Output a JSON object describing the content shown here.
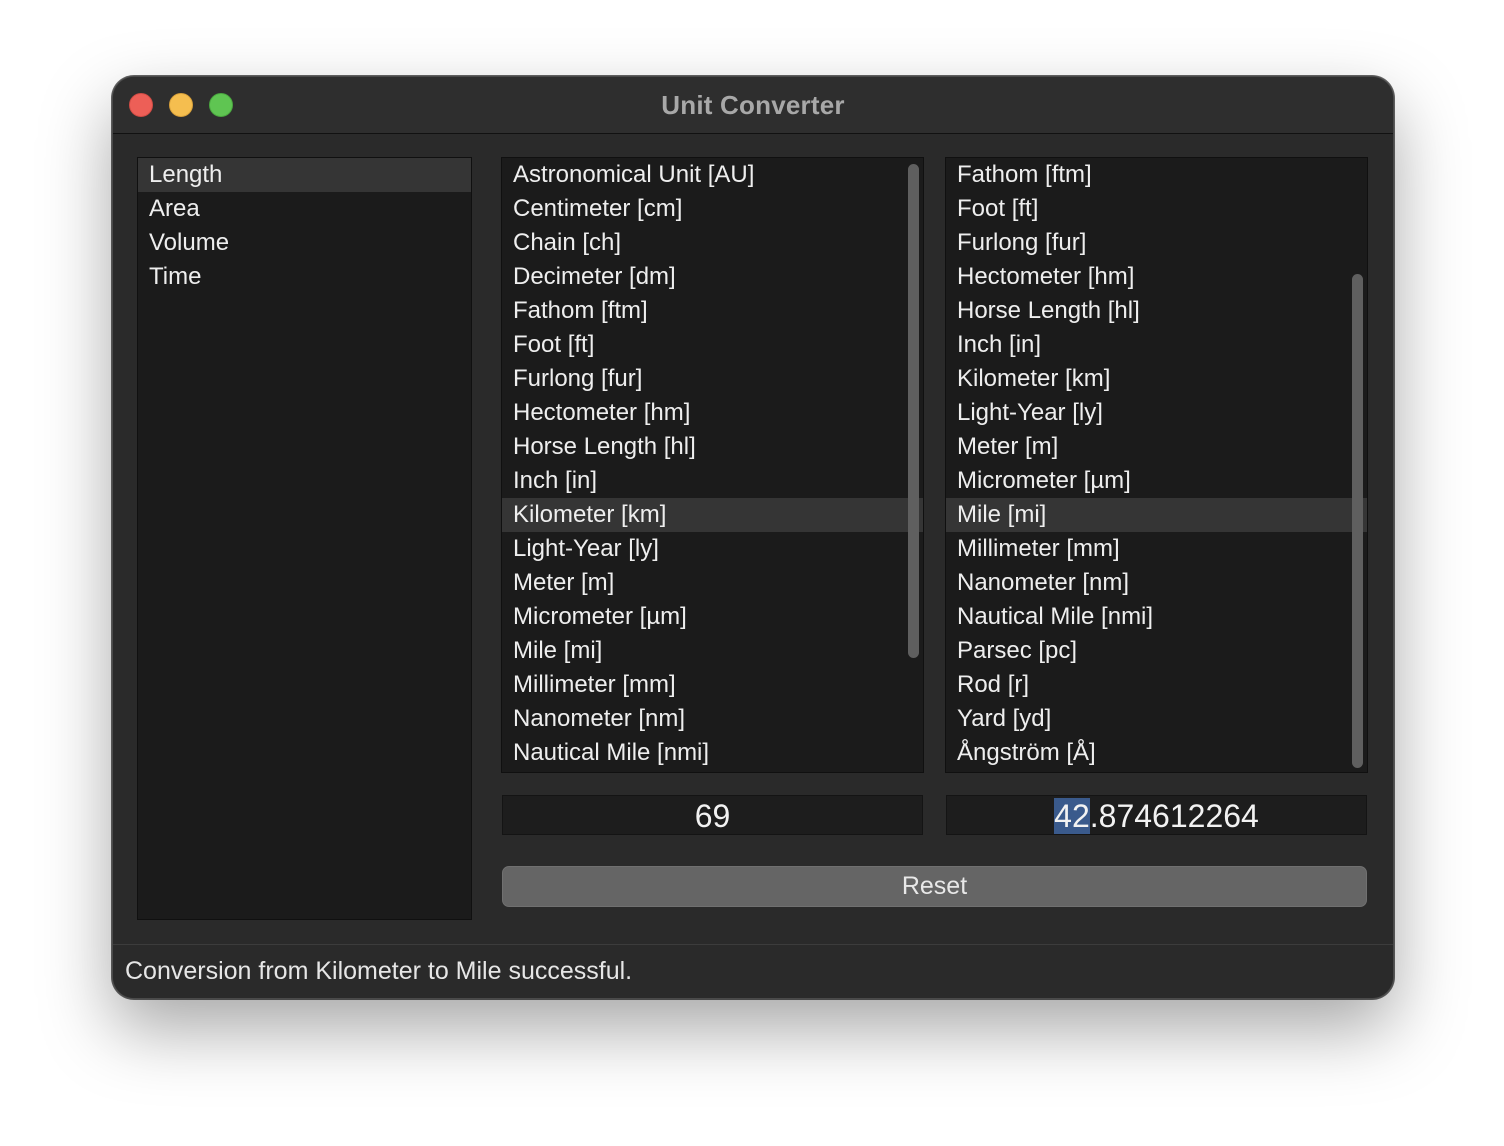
{
  "window": {
    "title": "Unit Converter"
  },
  "categories": {
    "items": [
      {
        "label": "Length"
      },
      {
        "label": "Area"
      },
      {
        "label": "Volume"
      },
      {
        "label": "Time"
      }
    ],
    "selected": "Length"
  },
  "from_units": {
    "items": [
      {
        "label": "Astronomical Unit [AU]"
      },
      {
        "label": "Centimeter [cm]"
      },
      {
        "label": "Chain [ch]"
      },
      {
        "label": "Decimeter [dm]"
      },
      {
        "label": "Fathom [ftm]"
      },
      {
        "label": "Foot [ft]"
      },
      {
        "label": "Furlong [fur]"
      },
      {
        "label": "Hectometer [hm]"
      },
      {
        "label": "Horse Length [hl]"
      },
      {
        "label": "Inch [in]"
      },
      {
        "label": "Kilometer [km]"
      },
      {
        "label": "Light-Year [ly]"
      },
      {
        "label": "Meter [m]"
      },
      {
        "label": "Micrometer [µm]"
      },
      {
        "label": "Mile [mi]"
      },
      {
        "label": "Millimeter [mm]"
      },
      {
        "label": "Nanometer [nm]"
      },
      {
        "label": "Nautical Mile [nmi]"
      }
    ],
    "selected": "Kilometer [km]"
  },
  "to_units": {
    "items": [
      {
        "label": "Fathom [ftm]"
      },
      {
        "label": "Foot [ft]"
      },
      {
        "label": "Furlong [fur]"
      },
      {
        "label": "Hectometer [hm]"
      },
      {
        "label": "Horse Length [hl]"
      },
      {
        "label": "Inch [in]"
      },
      {
        "label": "Kilometer [km]"
      },
      {
        "label": "Light-Year [ly]"
      },
      {
        "label": "Meter [m]"
      },
      {
        "label": "Micrometer [µm]"
      },
      {
        "label": "Mile [mi]"
      },
      {
        "label": "Millimeter [mm]"
      },
      {
        "label": "Nanometer [nm]"
      },
      {
        "label": "Nautical Mile [nmi]"
      },
      {
        "label": "Parsec [pc]"
      },
      {
        "label": "Rod [r]"
      },
      {
        "label": "Yard [yd]"
      },
      {
        "label": "Ångström [Å]"
      }
    ],
    "selected": "Mile [mi]"
  },
  "input": {
    "from_value": "69",
    "to_value_selected": "42",
    "to_value_rest": ".874612264"
  },
  "reset_label": "Reset",
  "status": {
    "message": "Conversion from Kilometer to Mile successful."
  },
  "colors": {
    "window_bg": "#2a2a2a",
    "list_bg": "#1b1b1b",
    "selection_bg": "#353535",
    "text_selection": "#3a5a8c",
    "close": "#ed5f57",
    "minimize": "#f5be4f",
    "maximize": "#5fc552"
  }
}
